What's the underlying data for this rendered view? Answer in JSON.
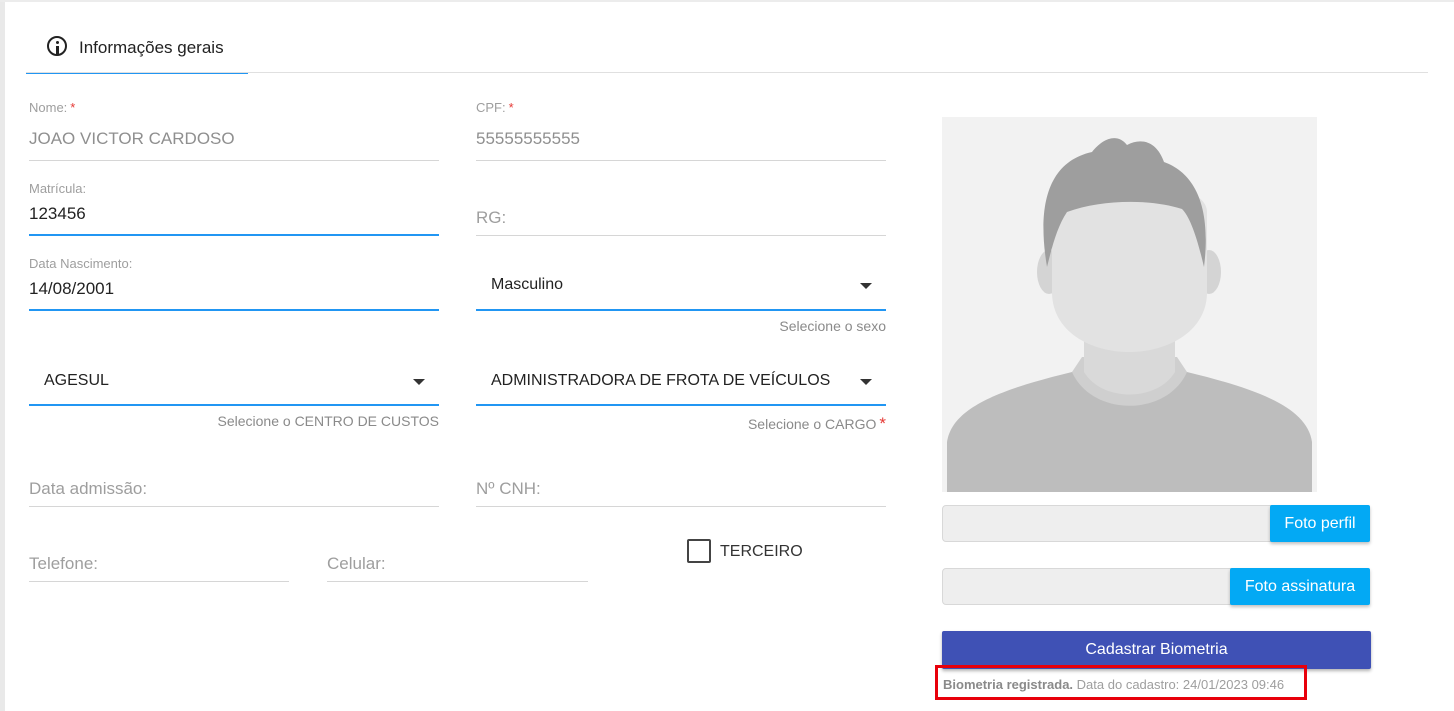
{
  "tab": {
    "label": "Informações gerais",
    "icon": "info-icon"
  },
  "form": {
    "nome": {
      "label": "Nome:",
      "required": "*",
      "value": "JOAO VICTOR CARDOSO"
    },
    "cpf": {
      "label": "CPF:",
      "required": "*",
      "value": "55555555555"
    },
    "matricula": {
      "label": "Matrícula:",
      "value": "123456"
    },
    "rg": {
      "placeholder": "RG:"
    },
    "data_nascimento": {
      "label": "Data Nascimento:",
      "value": "14/08/2001"
    },
    "sexo": {
      "value": "Masculino",
      "hint": "Selecione o sexo"
    },
    "centro_custos": {
      "value": "AGESUL",
      "hint": "Selecione o CENTRO DE CUSTOS"
    },
    "cargo": {
      "value": "ADMINISTRADORA DE FROTA DE VEÍCULOS",
      "hint": "Selecione o CARGO",
      "required": "*"
    },
    "data_admissao": {
      "placeholder": "Data admissão:"
    },
    "cnh": {
      "placeholder": "Nº CNH:"
    },
    "telefone": {
      "placeholder": "Telefone:"
    },
    "celular": {
      "placeholder": "Celular:"
    },
    "terceiro": {
      "label": "TERCEIRO",
      "checked": false
    }
  },
  "photo": {
    "foto_perfil_label": "Foto perfil",
    "foto_assinatura_label": "Foto assinatura",
    "biometria_button": "Cadastrar Biometria",
    "biometria_status_bold": "Biometria registrada.",
    "biometria_status_text": "Data do cadastro: 24/01/2023 09:46"
  },
  "colors": {
    "accent": "#2196f3",
    "upload_button": "#03a9f4",
    "primary_button": "#3f51b5",
    "required": "#e53935",
    "highlight_border": "#e8000b"
  }
}
